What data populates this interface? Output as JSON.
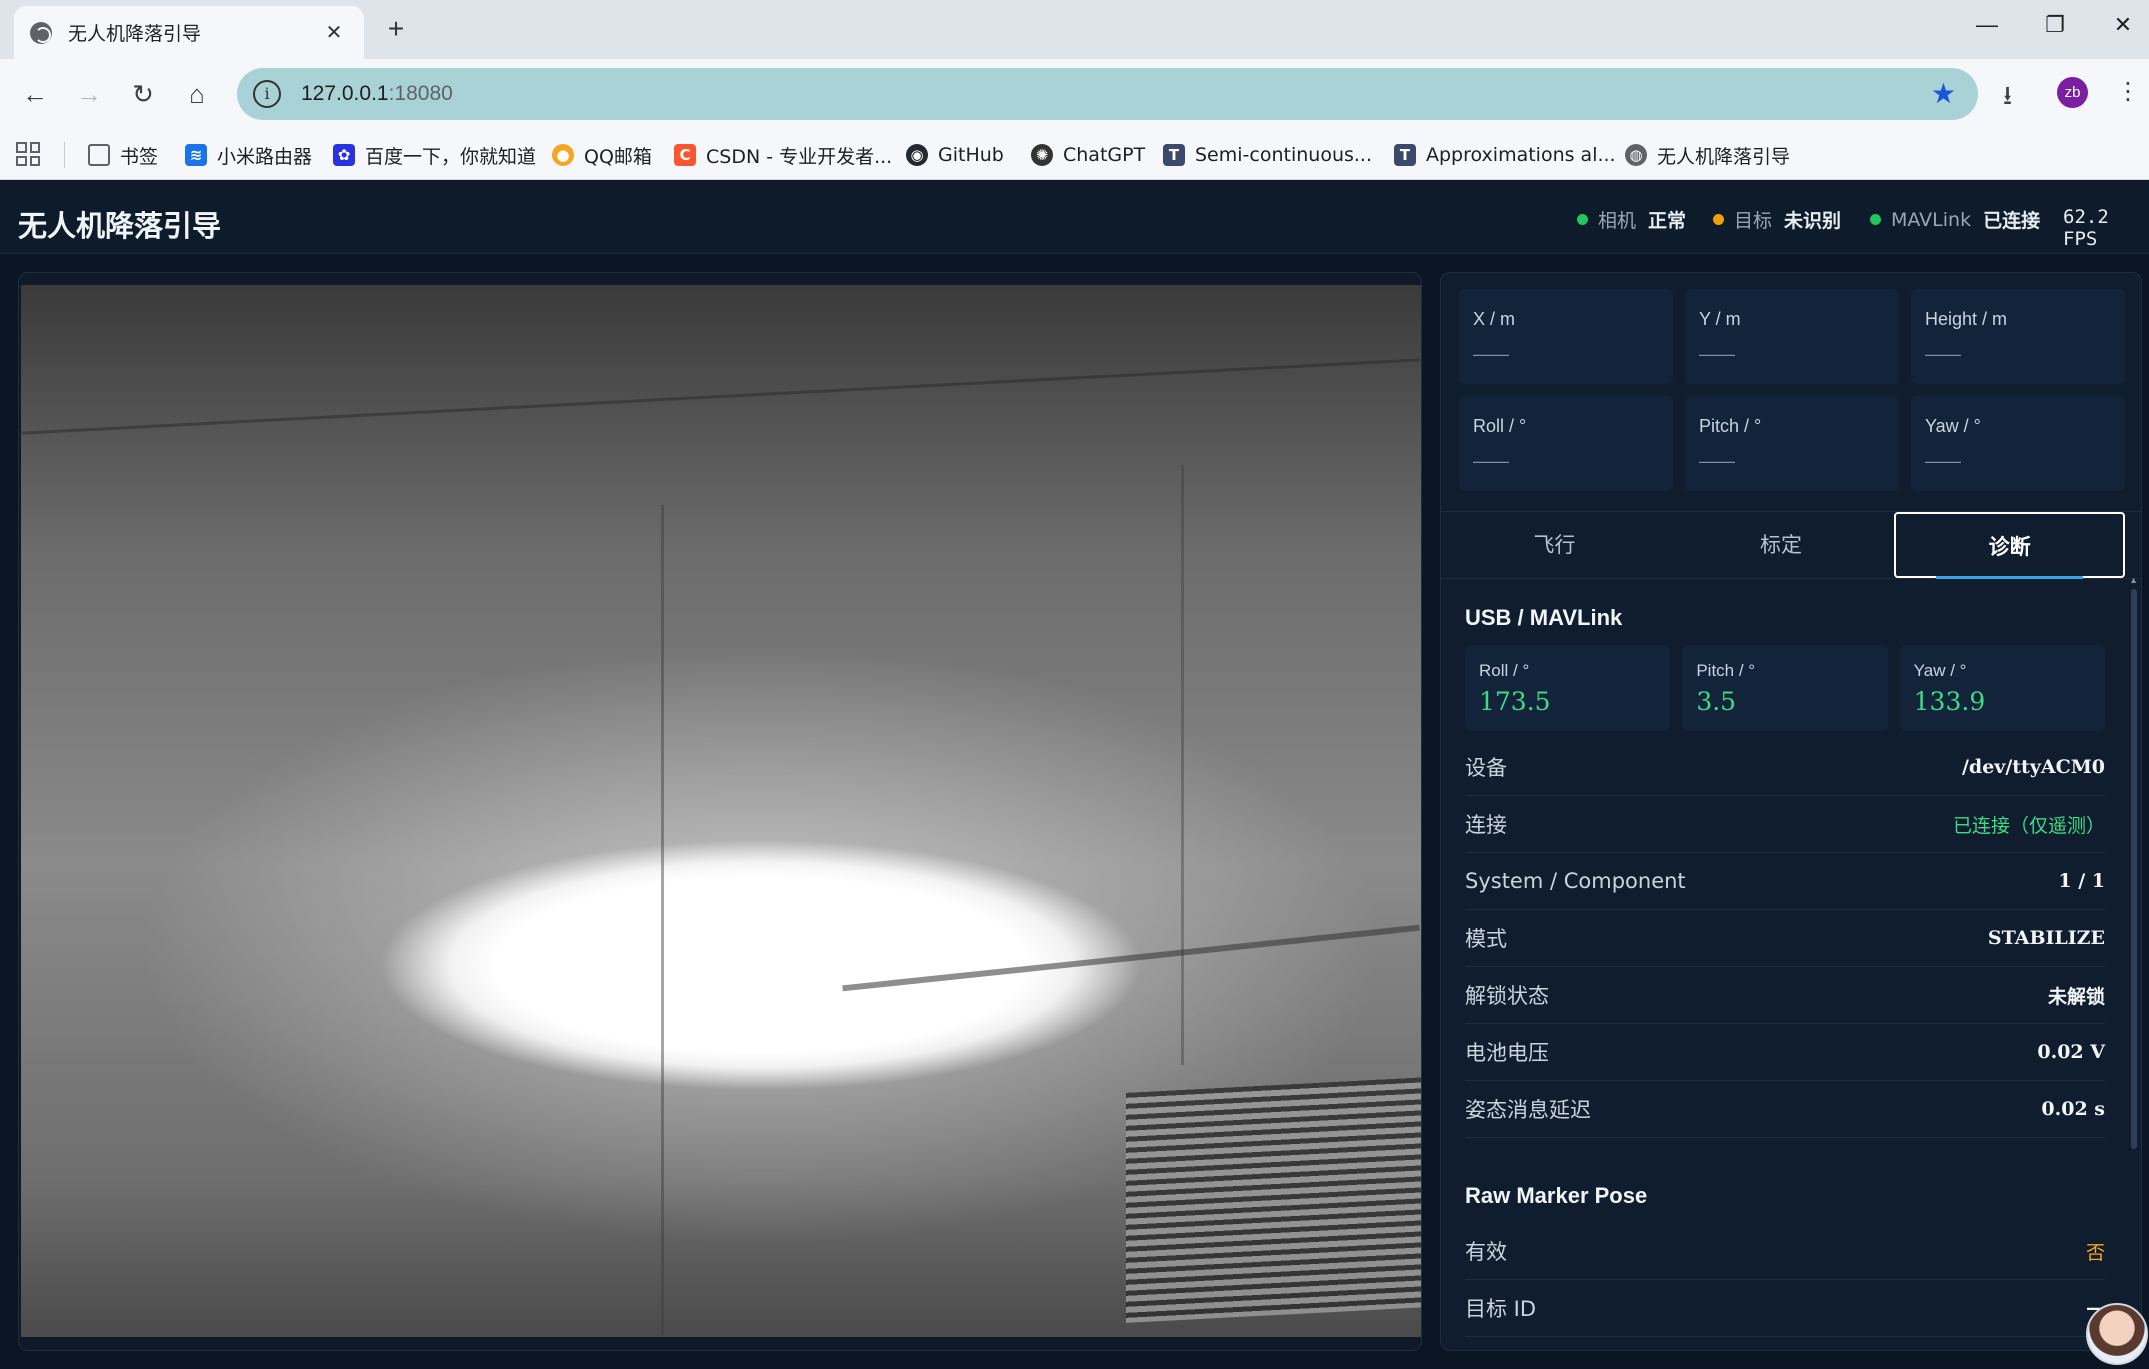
{
  "browser": {
    "tab_title": "无人机降落引导",
    "url_host": "127.0.0.1",
    "url_port": ":18080",
    "profile_initials": "zb",
    "bookmarks": [
      {
        "label": "书签",
        "icon": "folder-icon",
        "color": "#5f6368"
      },
      {
        "label": "小米路由器",
        "icon": "wifi-icon",
        "color": "#1a73e8"
      },
      {
        "label": "百度一下，你就知道",
        "icon": "baidu-icon",
        "color": "#2932e1"
      },
      {
        "label": "QQ邮箱",
        "icon": "qqmail-icon",
        "color": "#f5a623"
      },
      {
        "label": "CSDN - 专业开发者...",
        "icon": "csdn-icon",
        "color": "#fc5531"
      },
      {
        "label": "GitHub",
        "icon": "github-icon",
        "color": "#24292f"
      },
      {
        "label": "ChatGPT",
        "icon": "chatgpt-icon",
        "color": "#333333"
      },
      {
        "label": "Semi-continuous...",
        "icon": "t-icon",
        "color": "#3b4a6b"
      },
      {
        "label": "Approximations al...",
        "icon": "t-icon",
        "color": "#3b4a6b"
      },
      {
        "label": "无人机降落引导",
        "icon": "globe-icon",
        "color": "#5f6368"
      }
    ]
  },
  "app": {
    "title": "无人机降落引导",
    "status": [
      {
        "label": "相机",
        "value": "正常",
        "color": "#22c55e"
      },
      {
        "label": "目标",
        "value": "未识别",
        "color": "#f59e0b"
      },
      {
        "label": "MAVLink",
        "value": "已连接",
        "color": "#22c55e"
      }
    ],
    "fps": "62.2 FPS"
  },
  "pose": [
    {
      "key": "X / m",
      "value": "——"
    },
    {
      "key": "Y / m",
      "value": "——"
    },
    {
      "key": "Height / m",
      "value": "——"
    },
    {
      "key": "Roll / °",
      "value": "——"
    },
    {
      "key": "Pitch / °",
      "value": "——"
    },
    {
      "key": "Yaw / °",
      "value": "——"
    }
  ],
  "tabs": [
    "飞行",
    "标定",
    "诊断"
  ],
  "active_tab": "诊断",
  "diagnostics": {
    "usb_title": "USB / MAVLink",
    "attitude": [
      {
        "key": "Roll / °",
        "value": "173.5"
      },
      {
        "key": "Pitch / °",
        "value": "3.5"
      },
      {
        "key": "Yaw / °",
        "value": "133.9"
      }
    ],
    "rows": [
      {
        "key": "设备",
        "value": "/dev/ttyACM0",
        "style": ""
      },
      {
        "key": "连接",
        "value": "已连接（仅遥测）",
        "style": "green"
      },
      {
        "key": "System / Component",
        "value": "1 / 1",
        "style": ""
      },
      {
        "key": "模式",
        "value": "STABILIZE",
        "style": ""
      },
      {
        "key": "解锁状态",
        "value": "未解锁",
        "style": ""
      },
      {
        "key": "电池电压",
        "value": "0.02 V",
        "style": ""
      },
      {
        "key": "姿态消息延迟",
        "value": "0.02 s",
        "style": ""
      }
    ],
    "raw_title": "Raw Marker Pose",
    "raw_rows": [
      {
        "key": "有效",
        "value": "否",
        "style": "orange"
      },
      {
        "key": "目标 ID",
        "value": "—",
        "style": ""
      }
    ]
  }
}
